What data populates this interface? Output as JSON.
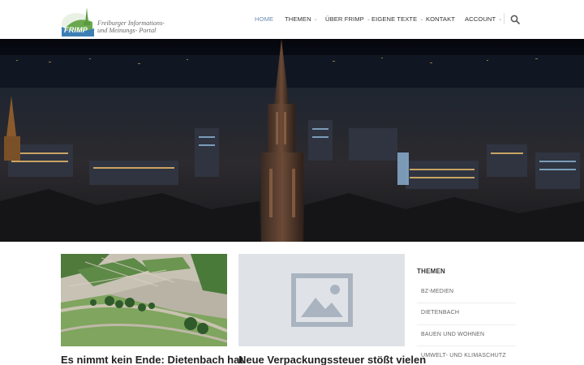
{
  "logo": {
    "brand": "FRIMP",
    "tagline_line1": "Freiburger Informations-",
    "tagline_line2": "und Meinungs- Portal"
  },
  "nav": {
    "items": [
      {
        "label": "HOME",
        "active": true,
        "has_dropdown": false
      },
      {
        "label": "THEMEN",
        "active": false,
        "has_dropdown": true
      },
      {
        "label": "ÜBER FRIMP",
        "active": false,
        "has_dropdown": true
      },
      {
        "label": "EIGENE TEXTE",
        "active": false,
        "has_dropdown": true
      },
      {
        "label": "KONTAKT",
        "active": false,
        "has_dropdown": false
      },
      {
        "label": "ACCOUNT",
        "active": false,
        "has_dropdown": true
      }
    ],
    "search_icon": "search-icon"
  },
  "posts": [
    {
      "title": "Es nimmt kein Ende: Dietenbach hat"
    },
    {
      "title": "Neue Verpackungssteuer stößt vielen"
    }
  ],
  "sidebar": {
    "title": "THEMEN",
    "items": [
      "BZ-MEDIEN",
      "DIETENBACH",
      "BAUEN UND WOHNEN",
      "UMWELT- UND KLIMASCHUTZ"
    ]
  },
  "colors": {
    "accent": "#6a8ab0",
    "logo_green": "#6aa84f",
    "logo_blue": "#3d7fb5",
    "placeholder_bg": "#dfe3e8"
  }
}
